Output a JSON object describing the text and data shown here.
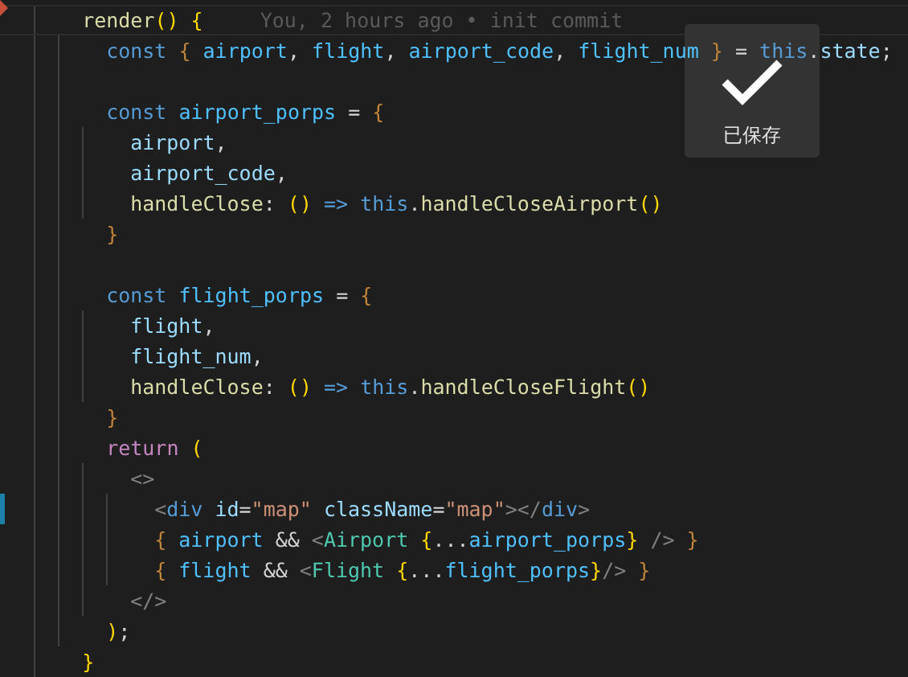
{
  "editor": {
    "lines": [
      {
        "kind": "code",
        "current": true,
        "gutter": {
          "kind": "deleted"
        },
        "blame": "You, 2 hours ago • init commit",
        "tokens": [
          {
            "kind": "function",
            "text": "render"
          },
          {
            "kind": "bracket",
            "text": "() "
          },
          {
            "kind": "bracket",
            "text": "{"
          }
        ],
        "children": [
          {
            "kind": "code",
            "current": false,
            "tokens": [
              {
                "kind": "keyword",
                "text": "const "
              },
              {
                "kind": "brace",
                "text": "{ "
              },
              {
                "kind": "constant",
                "text": "airport"
              },
              {
                "kind": "plain",
                "text": ", "
              },
              {
                "kind": "constant",
                "text": "flight"
              },
              {
                "kind": "plain",
                "text": ", "
              },
              {
                "kind": "constant",
                "text": "airport_code"
              },
              {
                "kind": "plain",
                "text": ", "
              },
              {
                "kind": "constant",
                "text": "flight_num "
              },
              {
                "kind": "brace",
                "text": "} "
              },
              {
                "kind": "plain",
                "text": "= "
              },
              {
                "kind": "keyword",
                "text": "this"
              },
              {
                "kind": "plain",
                "text": "."
              },
              {
                "kind": "variable",
                "text": "state"
              },
              {
                "kind": "plain",
                "text": ";"
              }
            ]
          },
          {
            "kind": "blank",
            "current": false
          },
          {
            "kind": "code",
            "current": false,
            "tokens": [
              {
                "kind": "keyword",
                "text": "const "
              },
              {
                "kind": "constant",
                "text": "airport_porps "
              },
              {
                "kind": "plain",
                "text": "= "
              },
              {
                "kind": "brace",
                "text": "{"
              }
            ],
            "children": [
              {
                "kind": "code",
                "current": false,
                "tokens": [
                  {
                    "kind": "variable",
                    "text": "airport"
                  },
                  {
                    "kind": "plain",
                    "text": ","
                  }
                ]
              },
              {
                "kind": "code",
                "current": false,
                "tokens": [
                  {
                    "kind": "variable",
                    "text": "airport_code"
                  },
                  {
                    "kind": "plain",
                    "text": ","
                  }
                ]
              },
              {
                "kind": "code",
                "current": false,
                "tokens": [
                  {
                    "kind": "function",
                    "text": "handleClose"
                  },
                  {
                    "kind": "plain",
                    "text": ": "
                  },
                  {
                    "kind": "bracket",
                    "text": "() "
                  },
                  {
                    "kind": "keyword",
                    "text": "=> "
                  },
                  {
                    "kind": "keyword",
                    "text": "this"
                  },
                  {
                    "kind": "plain",
                    "text": "."
                  },
                  {
                    "kind": "function",
                    "text": "handleCloseAirport"
                  },
                  {
                    "kind": "bracket",
                    "text": "()"
                  }
                ]
              }
            ]
          },
          {
            "kind": "code",
            "current": false,
            "tokens": [
              {
                "kind": "brace",
                "text": "}"
              }
            ]
          },
          {
            "kind": "blank",
            "current": false
          },
          {
            "kind": "code",
            "current": false,
            "tokens": [
              {
                "kind": "keyword",
                "text": "const "
              },
              {
                "kind": "constant",
                "text": "flight_porps "
              },
              {
                "kind": "plain",
                "text": "= "
              },
              {
                "kind": "brace",
                "text": "{"
              }
            ],
            "children": [
              {
                "kind": "code",
                "current": false,
                "tokens": [
                  {
                    "kind": "variable",
                    "text": "flight"
                  },
                  {
                    "kind": "plain",
                    "text": ","
                  }
                ]
              },
              {
                "kind": "code",
                "current": false,
                "tokens": [
                  {
                    "kind": "variable",
                    "text": "flight_num"
                  },
                  {
                    "kind": "plain",
                    "text": ","
                  }
                ]
              },
              {
                "kind": "code",
                "current": false,
                "tokens": [
                  {
                    "kind": "function",
                    "text": "handleClose"
                  },
                  {
                    "kind": "plain",
                    "text": ": "
                  },
                  {
                    "kind": "bracket",
                    "text": "() "
                  },
                  {
                    "kind": "keyword",
                    "text": "=> "
                  },
                  {
                    "kind": "keyword",
                    "text": "this"
                  },
                  {
                    "kind": "plain",
                    "text": "."
                  },
                  {
                    "kind": "function",
                    "text": "handleCloseFlight"
                  },
                  {
                    "kind": "bracket",
                    "text": "()"
                  }
                ]
              }
            ]
          },
          {
            "kind": "code",
            "current": false,
            "tokens": [
              {
                "kind": "brace",
                "text": "}"
              }
            ]
          },
          {
            "kind": "code",
            "current": false,
            "tokens": [
              {
                "kind": "control",
                "text": "return "
              },
              {
                "kind": "bracket",
                "text": "("
              }
            ],
            "children": [
              {
                "kind": "code",
                "current": false,
                "tokens": [
                  {
                    "kind": "tag",
                    "text": "<>"
                  }
                ],
                "children": [
                  {
                    "kind": "code",
                    "current": false,
                    "gutter": {
                      "kind": "modified"
                    },
                    "tokens": [
                      {
                        "kind": "tag",
                        "text": "<"
                      },
                      {
                        "kind": "keyword",
                        "text": "div "
                      },
                      {
                        "kind": "variable",
                        "text": "id"
                      },
                      {
                        "kind": "plain",
                        "text": "="
                      },
                      {
                        "kind": "string",
                        "text": "\"map\" "
                      },
                      {
                        "kind": "variable",
                        "text": "className"
                      },
                      {
                        "kind": "plain",
                        "text": "="
                      },
                      {
                        "kind": "string",
                        "text": "\"map\""
                      },
                      {
                        "kind": "tag",
                        "text": "></"
                      },
                      {
                        "kind": "keyword",
                        "text": "div"
                      },
                      {
                        "kind": "tag",
                        "text": ">"
                      }
                    ]
                  },
                  {
                    "kind": "code",
                    "current": false,
                    "tokens": [
                      {
                        "kind": "brace",
                        "text": "{ "
                      },
                      {
                        "kind": "constant",
                        "text": "airport "
                      },
                      {
                        "kind": "plain",
                        "text": "&& "
                      },
                      {
                        "kind": "tag",
                        "text": "<"
                      },
                      {
                        "kind": "component",
                        "text": "Airport "
                      },
                      {
                        "kind": "bracket",
                        "text": "{"
                      },
                      {
                        "kind": "plain",
                        "text": "..."
                      },
                      {
                        "kind": "constant",
                        "text": "airport_porps"
                      },
                      {
                        "kind": "bracket",
                        "text": "} "
                      },
                      {
                        "kind": "tag",
                        "text": "/> "
                      },
                      {
                        "kind": "brace",
                        "text": "}"
                      }
                    ]
                  },
                  {
                    "kind": "code",
                    "current": false,
                    "tokens": [
                      {
                        "kind": "brace",
                        "text": "{ "
                      },
                      {
                        "kind": "constant",
                        "text": "flight "
                      },
                      {
                        "kind": "plain",
                        "text": "&& "
                      },
                      {
                        "kind": "tag",
                        "text": "<"
                      },
                      {
                        "kind": "component",
                        "text": "Flight "
                      },
                      {
                        "kind": "bracket",
                        "text": "{"
                      },
                      {
                        "kind": "plain",
                        "text": "..."
                      },
                      {
                        "kind": "constant",
                        "text": "flight_porps"
                      },
                      {
                        "kind": "bracket",
                        "text": "}"
                      },
                      {
                        "kind": "tag",
                        "text": "/> "
                      },
                      {
                        "kind": "brace",
                        "text": "}"
                      }
                    ]
                  }
                ]
              },
              {
                "kind": "code",
                "current": false,
                "tokens": [
                  {
                    "kind": "tag",
                    "text": "</>"
                  }
                ]
              }
            ]
          },
          {
            "kind": "code",
            "current": false,
            "tokens": [
              {
                "kind": "bracket",
                "text": ")"
              },
              {
                "kind": "plain",
                "text": ";"
              }
            ]
          }
        ]
      },
      {
        "kind": "code",
        "current": false,
        "tokens": [
          {
            "kind": "bracket",
            "text": "}"
          }
        ]
      }
    ]
  },
  "toast": {
    "text": "已保存"
  }
}
